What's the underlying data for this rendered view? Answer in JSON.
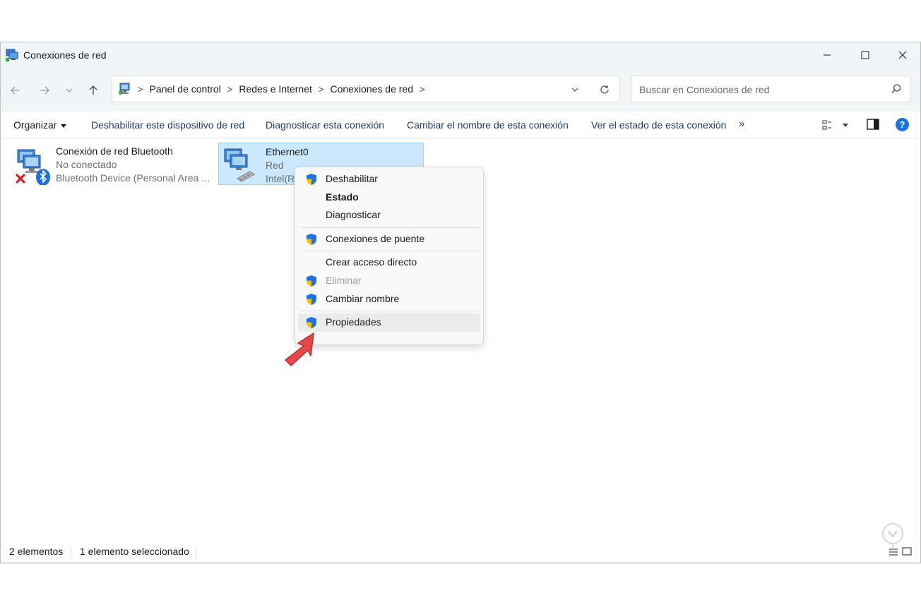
{
  "window": {
    "title": "Conexiones de red",
    "controls": {
      "minimize": "minimize-icon",
      "maximize": "maximize-icon",
      "close": "close-icon"
    }
  },
  "navigation": {
    "back": "arrow-left-icon",
    "forward": "arrow-right-icon",
    "recent": "chevron-down-icon",
    "up": "arrow-up-icon",
    "breadcrumbs": [
      "Panel de control",
      "Redes e Internet",
      "Conexiones de red"
    ],
    "refresh": "refresh-icon"
  },
  "search": {
    "placeholder": "Buscar en Conexiones de red",
    "value": ""
  },
  "commandbar": {
    "organize": "Organizar",
    "disable_device": "Deshabilitar este dispositivo de red",
    "diagnose": "Diagnosticar esta conexión",
    "rename": "Cambiar el nombre de esta conexión",
    "view_status": "Ver el estado de esta conexión",
    "more": "»",
    "help": "?"
  },
  "items": [
    {
      "name": "Conexión de red Bluetooth",
      "status": "No conectado",
      "device": "Bluetooth Device (Personal Area ...",
      "selected": false
    },
    {
      "name": "Ethernet0",
      "status": "Red",
      "device": "Intel(R)",
      "selected": true
    }
  ],
  "context_menu": {
    "items": [
      {
        "label": "Deshabilitar",
        "shield": true,
        "bold": false,
        "disabled": false
      },
      {
        "label": "Estado",
        "shield": false,
        "bold": true,
        "disabled": false
      },
      {
        "label": "Diagnosticar",
        "shield": false,
        "bold": false,
        "disabled": false
      },
      {
        "label": "Conexiones de puente",
        "shield": true,
        "bold": false,
        "disabled": false
      },
      {
        "label": "Crear acceso directo",
        "shield": false,
        "bold": false,
        "disabled": false
      },
      {
        "label": "Eliminar",
        "shield": true,
        "bold": false,
        "disabled": true
      },
      {
        "label": "Cambiar nombre",
        "shield": true,
        "bold": false,
        "disabled": false
      },
      {
        "label": "Propiedades",
        "shield": true,
        "bold": false,
        "disabled": false,
        "highlighted": true
      }
    ]
  },
  "statusbar": {
    "count": "2 elementos",
    "selection": "1 elemento seleccionado"
  },
  "colors": {
    "selection_bg": "#cce8ff",
    "command_text": "#1d3a6e",
    "help_blue": "#1a73e8",
    "pointer_red": "#e8474a"
  }
}
